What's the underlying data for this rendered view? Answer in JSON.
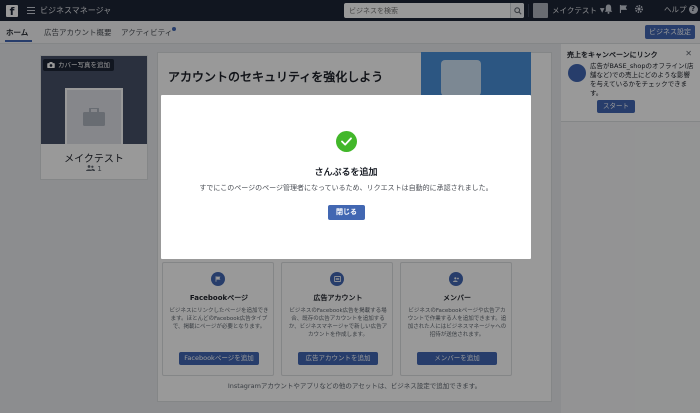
{
  "topbar": {
    "logo": "f",
    "app_title": "ビジネスマネージャ",
    "search_placeholder": "ビジネスを検索",
    "account_name": "メイクテスト",
    "help_label": "ヘルプ"
  },
  "subnav": {
    "tabs": [
      {
        "label": "ホーム",
        "active": true
      },
      {
        "label": "広告アカウント概要",
        "active": false
      },
      {
        "label": "アクティビティ",
        "active": false,
        "has_notification": true
      }
    ],
    "settings_button": "ビジネス設定"
  },
  "profile": {
    "cover_button": "カバー写真を追加",
    "name": "メイクテスト",
    "member_count": "1"
  },
  "security": {
    "title": "アカウントのセキュリティを強化しよう"
  },
  "assets": [
    {
      "icon": "flag-icon",
      "title": "Facebookページ",
      "description": "ビジネスにリンクしたページを追加できます。ほとんどのFacebook広告タイプで、掲載にページが必要となります。",
      "button": "Facebookページを追加"
    },
    {
      "icon": "ad-account-icon",
      "title": "広告アカウント",
      "description": "ビジネスのFacebook広告を掲載する場合、既存の広告アカウントを追加するか、ビジネスマネージャで新しい広告アカウントを作成します。",
      "button": "広告アカウントを追加"
    },
    {
      "icon": "people-icon",
      "title": "メンバー",
      "description": "ビジネスのFacebookページや広告アカウントで作業する人を追加できます。追加された人にはビジネスマネージャへの招待が送信されます。",
      "button": "メンバーを追加"
    }
  ],
  "footer_note": "Instagramアカウントやアプリなどの他のアセットは、ビジネス設定で追加できます。",
  "promo": {
    "title": "売上をキャンペーンにリンク",
    "text": "広告がBASE_shopのオフライン(店舗など)での売上にどのような影響を与えているかをチェックできます。",
    "button": "スタート"
  },
  "modal": {
    "title": "さんぷるを追加",
    "message": "すでにこのページのページ管理者になっているため、リクエストは自動的に承認されました。",
    "close_button": "閉じる"
  },
  "colors": {
    "topbar": "#1d2536",
    "accent": "#4267b2",
    "success": "#42b72a"
  }
}
